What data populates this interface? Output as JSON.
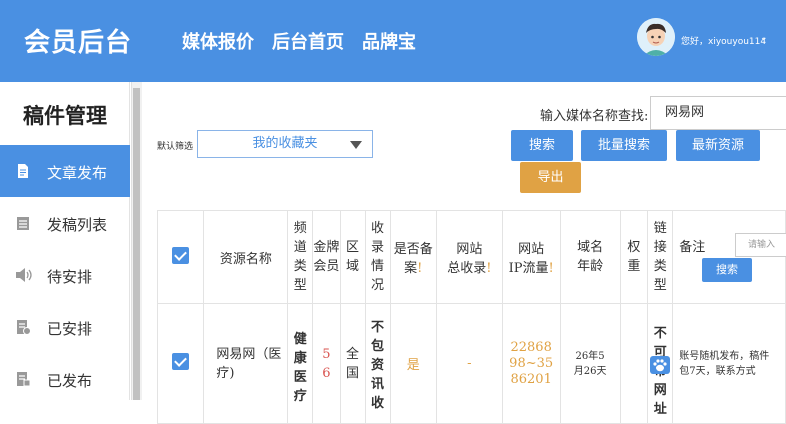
{
  "header": {
    "brand": "会员后台",
    "nav": [
      "媒体报价",
      "后台首页",
      "品牌宝"
    ],
    "greeting": "您好，xiyouyou114"
  },
  "sidebar": {
    "title": "稿件管理",
    "items": [
      {
        "label": "文章发布",
        "icon": "document-icon",
        "active": true
      },
      {
        "label": "发稿列表",
        "icon": "list-icon",
        "active": false
      },
      {
        "label": "待安排",
        "icon": "speaker-icon",
        "active": false
      },
      {
        "label": "已安排",
        "icon": "checklist-icon",
        "active": false
      },
      {
        "label": "已发布",
        "icon": "published-icon",
        "active": false
      }
    ]
  },
  "search": {
    "label": "输入媒体名称查找:",
    "value": "网易网",
    "filter_label": "默认筛选",
    "filter_value": "我的收藏夹"
  },
  "buttons": {
    "search": "搜索",
    "batch_search": "批量搜索",
    "latest": "最新资源",
    "export": "导出"
  },
  "table": {
    "headers": {
      "resource_name": "资源名称",
      "channel_type": "频道类型",
      "gold_member": "金牌会员",
      "region": "区域",
      "indexing": "收录情况",
      "filed": "是否备案",
      "total_index_1": "网站",
      "total_index_2": "总收录",
      "traffic_1": "网站",
      "traffic_2": "IP流量",
      "domain_age": "域名年龄",
      "weight": "权重",
      "link_type": "链接类型",
      "note": "备注",
      "note_placeholder": "请输入",
      "note_search": "搜索",
      "excl": "!"
    },
    "rows": [
      {
        "name": "网易网（医疗)",
        "channel": "健康医疗",
        "gold": "56",
        "region": "全国",
        "indexing": "不包资讯收",
        "filed": "是",
        "total_index": "-",
        "traffic": "2286898~3586201",
        "domain_age": "26年5月26天",
        "link_type": "不可带网址",
        "note": "账号随机发布，稿件包7天，联系方式"
      }
    ]
  },
  "colors": {
    "primary": "#4a90e2",
    "accent": "#e0a244",
    "red": "#d9534f"
  }
}
